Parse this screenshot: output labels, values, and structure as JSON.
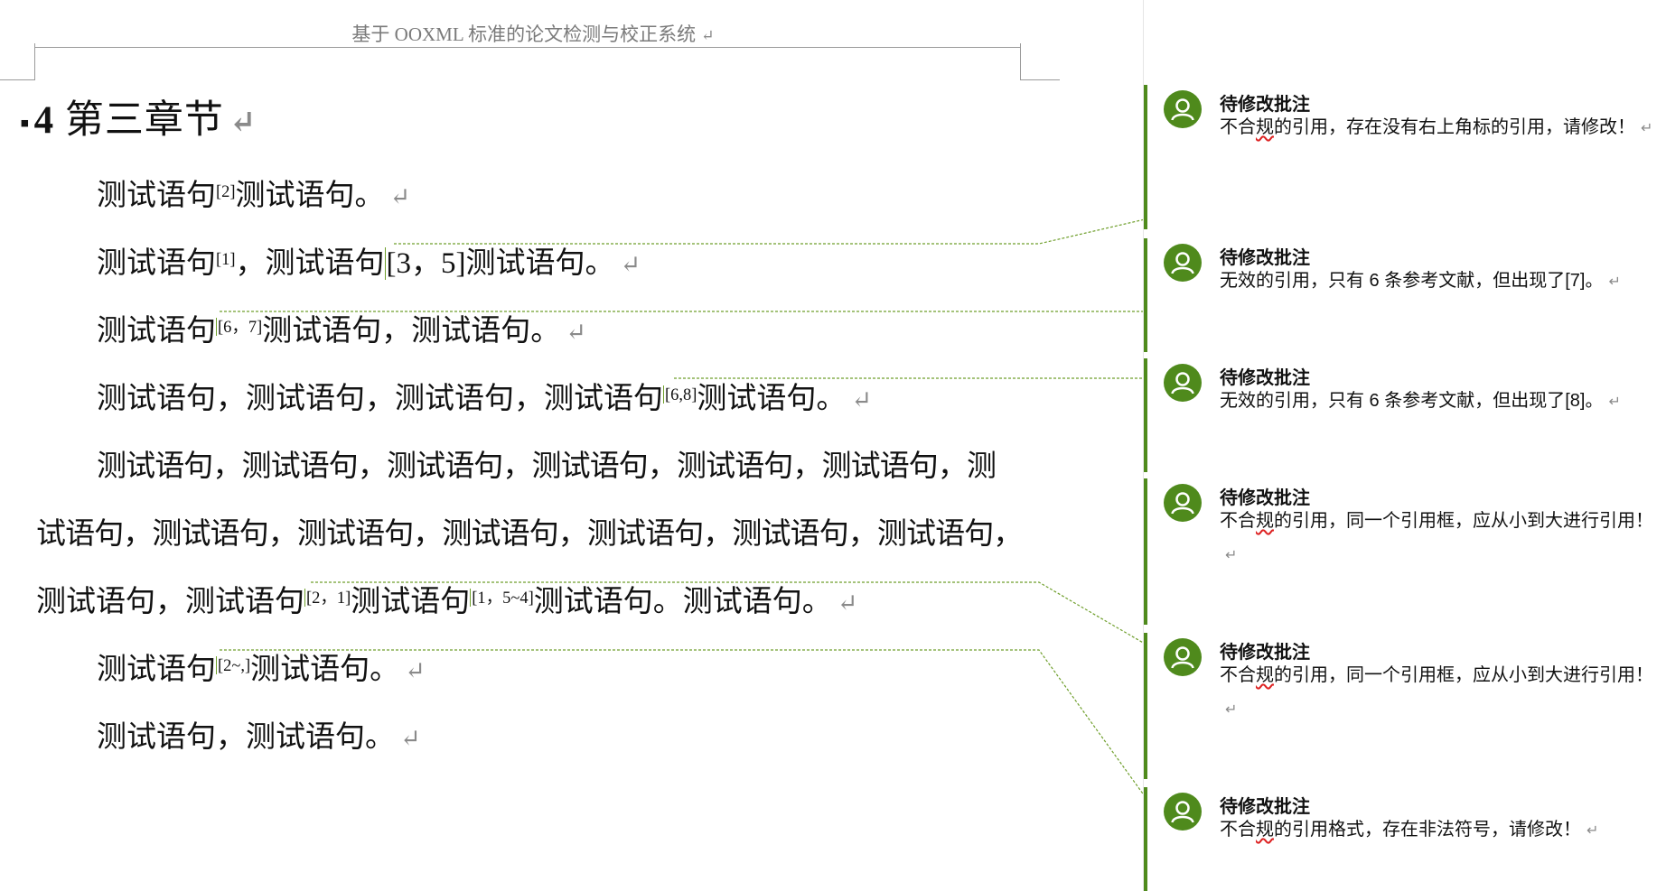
{
  "header": {
    "text": "基于 OOXML 标准的论文检测与校正系统"
  },
  "heading": {
    "number": "4",
    "title": "第三章节"
  },
  "paragraph_mark": "↵",
  "body": {
    "l1": {
      "a": "测试语句",
      "s1": "[2]",
      "b": "测试语句。"
    },
    "l2": {
      "a": "测试语句",
      "s1": "[1]",
      "b": "，测试语句",
      "c": "[3，5]",
      "d": "测试语句。"
    },
    "l3": {
      "a": "测试语句",
      "s1": "[6，7]",
      "b": "测试语句，测试语句。"
    },
    "l4": {
      "a": "测试语句，测试语句，测试语句，测试语句",
      "s1": "[6,8]",
      "b": "测试语句。"
    },
    "l5": {
      "a": "测试语句，测试语句，测试语句，测试语句，测试语句，测试语句，测"
    },
    "l6": {
      "a": "试语句，测试语句，测试语句，测试语句，测试语句，测试语句，测试语句，"
    },
    "l7": {
      "a": "测试语句，测试语句",
      "s1": "[2，1]",
      "b": "测试语句",
      "s2": "[1，5~4]",
      "c": "测试语句。测试语句。"
    },
    "l8": {
      "a": "测试语句",
      "s1": "[2~,]",
      "b": "测试语句。"
    },
    "l9": {
      "a": "测试语句，测试语句。"
    }
  },
  "comments": [
    {
      "author": "待修改批注",
      "pre": "不合",
      "sq": "规",
      "post": "的引用，存在没有右上角标的引用，请修改！"
    },
    {
      "author": "待修改批注",
      "pre": "无效的引用，只有 6 条参考文献，但出现了[7]。",
      "sq": "",
      "post": ""
    },
    {
      "author": "待修改批注",
      "pre": "无效的引用，只有 6 条参考文献，但出现了[8]。",
      "sq": "",
      "post": ""
    },
    {
      "author": "待修改批注",
      "pre": "不合",
      "sq": "规",
      "post": "的引用，同一个引用框，应从小到大进行引用！"
    },
    {
      "author": "待修改批注",
      "pre": "不合",
      "sq": "规",
      "post": "的引用，同一个引用框，应从小到大进行引用！"
    },
    {
      "author": "待修改批注",
      "pre": "不合",
      "sq": "规",
      "post": "的引用格式，存在非法符号，请修改！"
    }
  ],
  "colors": {
    "accent": "#4f8a1c",
    "connector": "#6f9f2c",
    "squiggle": "#dd2222"
  },
  "icons": {
    "avatar": "user-avatar-icon",
    "paragraph": "paragraph-mark-icon"
  }
}
